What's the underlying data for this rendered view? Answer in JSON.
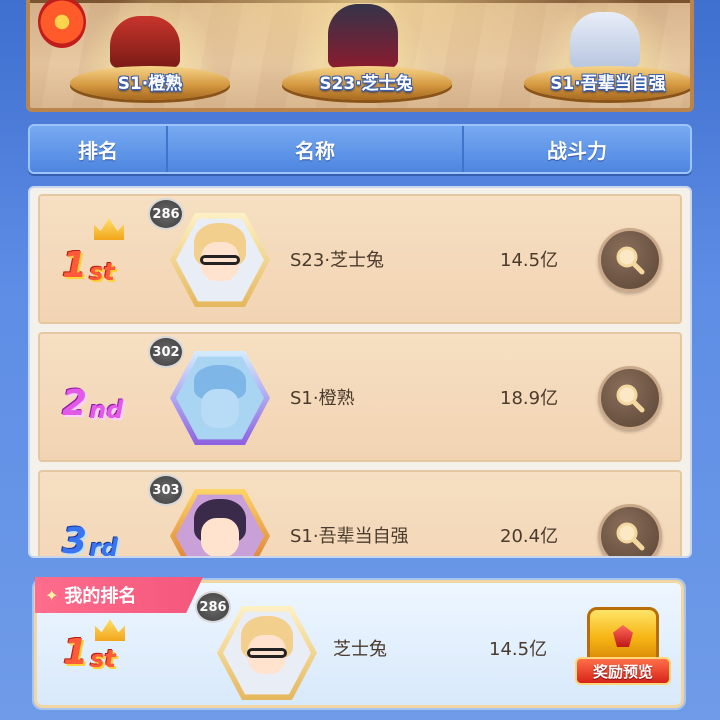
{
  "podium": {
    "left_label": "S1·橙熟",
    "center_label": "S23·芝士兔",
    "right_label": "S1·吾辈当自强"
  },
  "header": {
    "rank": "排名",
    "name": "名称",
    "power": "战斗力"
  },
  "rows": [
    {
      "rank": "1",
      "suffix": "st",
      "level": "286",
      "name": "S23·芝士兔",
      "power": "14.5亿",
      "avatar_color": "#f3cf8d",
      "rank_color": "#ff5a3a"
    },
    {
      "rank": "2",
      "suffix": "nd",
      "level": "302",
      "name": "S1·橙熟",
      "power": "18.9亿",
      "avatar_color": "#7fb6e8",
      "rank_color": "#e25ae8"
    },
    {
      "rank": "3",
      "suffix": "rd",
      "level": "303",
      "name": "S1·吾辈当自强",
      "power": "20.4亿",
      "avatar_color": "#3a2b4a",
      "rank_color": "#3a74f0"
    }
  ],
  "my_rank": {
    "tag": "我的排名",
    "rank": "1",
    "suffix": "st",
    "level": "286",
    "name": "芝士兔",
    "power": "14.5亿",
    "reward_label": "奖励预览"
  },
  "icons": {
    "view": "magnifier-icon",
    "crown": "crown-icon",
    "chest": "treasure-chest-icon",
    "tag_star": "sparkle-icon"
  }
}
